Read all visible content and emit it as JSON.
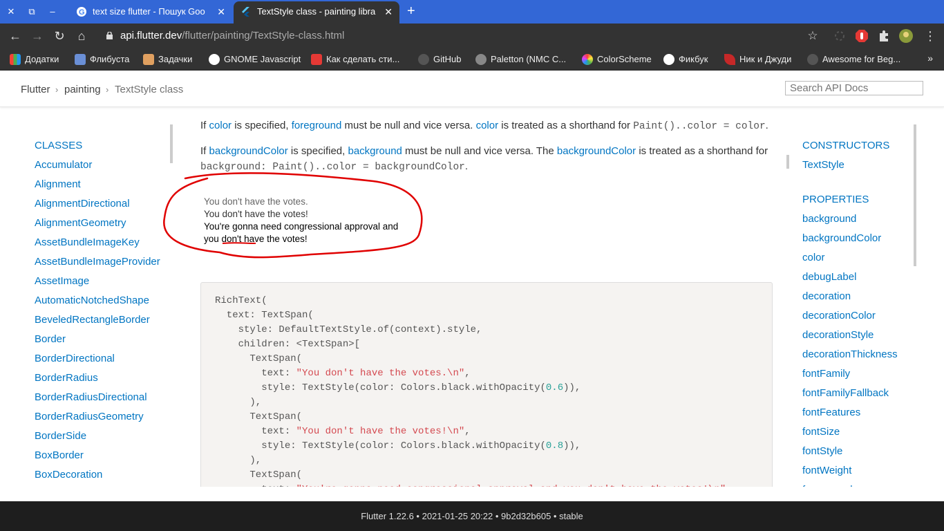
{
  "browser": {
    "tabs": [
      {
        "title": "text size flutter - Пошук Goo",
        "close": "✕"
      },
      {
        "title": "TextStyle class - painting libra",
        "close": "✕"
      }
    ],
    "window_close": "✕",
    "window_restore": "⧉",
    "window_minimize": "–",
    "new_tab": "+",
    "url_host": "api.flutter.dev",
    "url_path": "/flutter/painting/TextStyle-class.html",
    "bookmarks": [
      {
        "label": "Додатки",
        "icon": "apps-grid-icon",
        "color": "#f4b400"
      },
      {
        "label": "Флибуста",
        "icon": "flibusta-icon",
        "color": "#6a8fd6"
      },
      {
        "label": "Задачки",
        "icon": "tasks-icon",
        "color": "#e0a060"
      },
      {
        "label": "GNOME Javascript",
        "icon": "gnome-icon",
        "color": "#ffffff"
      },
      {
        "label": "Как сделать сти...",
        "icon": "bookmark-red-icon",
        "color": "#e53935"
      },
      {
        "label": "GitHub",
        "icon": "github-icon",
        "color": "#444444"
      },
      {
        "label": "Paletton (NMC C...",
        "icon": "paletton-icon",
        "color": "#888888"
      },
      {
        "label": "ColorScheme",
        "icon": "colorwheel-icon",
        "color": "#e040fb"
      },
      {
        "label": "Фикбук",
        "icon": "globe-icon",
        "color": "#ffffff"
      },
      {
        "label": "Ник и Джуди",
        "icon": "feather-icon",
        "color": "#c62828"
      },
      {
        "label": "Awesome for Beg...",
        "icon": "github-icon",
        "color": "#444444"
      }
    ],
    "bookmarks_more": "»"
  },
  "breadcrumb": {
    "items": [
      "Flutter",
      "painting",
      "TextStyle class"
    ],
    "sep": "›",
    "search_placeholder": "Search API Docs"
  },
  "leftnav": {
    "heading": "CLASSES",
    "items": [
      "Accumulator",
      "Alignment",
      "AlignmentDirectional",
      "AlignmentGeometry",
      "AssetBundleImageKey",
      "AssetBundleImageProvider",
      "AssetImage",
      "AutomaticNotchedShape",
      "BeveledRectangleBorder",
      "Border",
      "BorderDirectional",
      "BorderRadius",
      "BorderRadiusDirectional",
      "BorderRadiusGeometry",
      "BorderSide",
      "BoxBorder",
      "BoxDecoration"
    ]
  },
  "main": {
    "p1": {
      "t1": "If ",
      "l1": "color",
      "t2": " is specified, ",
      "l2": "foreground",
      "t3": " must be null and vice versa. ",
      "l3": "color",
      "t4": " is treated as a shorthand for ",
      "c1": "Paint()..color = color",
      "t5": "."
    },
    "p2": {
      "t1": "If ",
      "l1": "backgroundColor",
      "t2": " is specified, ",
      "l2": "background",
      "t3": " must be null and vice versa. The ",
      "l3": "backgroundColor",
      "t4": " is treated as a shorthand for",
      "c1": "background: Paint()..color = backgroundColor",
      "t5": "."
    },
    "demo_lines": [
      "You don't have the votes.",
      "You don't have the votes!",
      "You're gonna need congressional approval and",
      "you don't have the votes!"
    ],
    "demo_colors": [
      "#666666",
      "#333333",
      "#000000",
      "#000000"
    ],
    "code": [
      {
        "txt": "RichText("
      },
      {
        "txt": "  text: TextSpan("
      },
      {
        "txt": "    style: DefaultTextStyle.of(context).style,"
      },
      {
        "txt": "    children: <TextSpan>["
      },
      {
        "txt": "      TextSpan("
      },
      {
        "pre": "        text: ",
        "str": "\"You don't have the votes.\\n\"",
        "post": ","
      },
      {
        "pre": "        style: TextStyle(color: Colors.black.withOpacity(",
        "num": "0.6",
        "post": ")),"
      },
      {
        "txt": "      ),"
      },
      {
        "txt": "      TextSpan("
      },
      {
        "pre": "        text: ",
        "str": "\"You don't have the votes!\\n\"",
        "post": ","
      },
      {
        "pre": "        style: TextStyle(color: Colors.black.withOpacity(",
        "num": "0.8",
        "post": ")),"
      },
      {
        "txt": "      ),"
      },
      {
        "txt": "      TextSpan("
      },
      {
        "pre": "        text: ",
        "str": "\"You're gonna need congressional approval and you don't have the votes!\\n\"",
        "post": ","
      }
    ]
  },
  "rightnav": {
    "constructors_heading": "CONSTRUCTORS",
    "constructors": [
      "TextStyle"
    ],
    "properties_heading": "PROPERTIES",
    "properties": [
      "background",
      "backgroundColor",
      "color",
      "debugLabel",
      "decoration",
      "decorationColor",
      "decorationStyle",
      "decorationThickness",
      "fontFamily",
      "fontFamilyFallback",
      "fontFeatures",
      "fontSize",
      "fontStyle",
      "fontWeight",
      "foreground"
    ]
  },
  "footer": "Flutter 1.22.6 • 2021-01-25 20:22 • 9b2d32b605 • stable",
  "colors": {
    "link": "#0175c2",
    "tabstrip": "#3367d6",
    "toolbar": "#333333",
    "annotation": "#e00000"
  }
}
